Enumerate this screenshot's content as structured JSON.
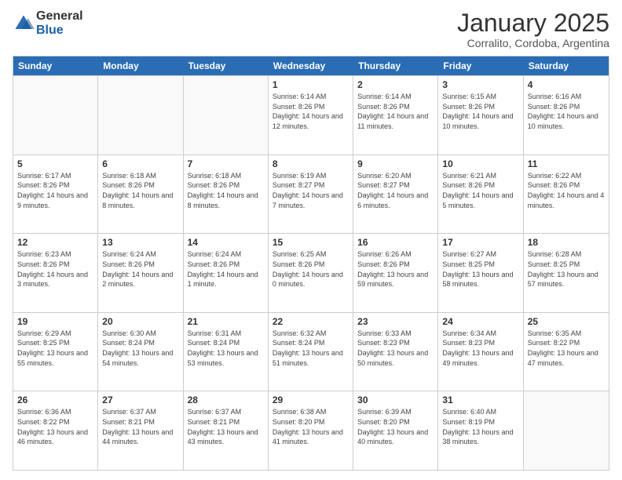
{
  "logo": {
    "general": "General",
    "blue": "Blue"
  },
  "header": {
    "month": "January 2025",
    "location": "Corralito, Cordoba, Argentina"
  },
  "days_of_week": [
    "Sunday",
    "Monday",
    "Tuesday",
    "Wednesday",
    "Thursday",
    "Friday",
    "Saturday"
  ],
  "weeks": [
    [
      {
        "day": "",
        "sunrise": "",
        "sunset": "",
        "daylight": "",
        "empty": true
      },
      {
        "day": "",
        "sunrise": "",
        "sunset": "",
        "daylight": "",
        "empty": true
      },
      {
        "day": "",
        "sunrise": "",
        "sunset": "",
        "daylight": "",
        "empty": true
      },
      {
        "day": "1",
        "sunrise": "Sunrise: 6:14 AM",
        "sunset": "Sunset: 8:26 PM",
        "daylight": "Daylight: 14 hours and 12 minutes."
      },
      {
        "day": "2",
        "sunrise": "Sunrise: 6:14 AM",
        "sunset": "Sunset: 8:26 PM",
        "daylight": "Daylight: 14 hours and 11 minutes."
      },
      {
        "day": "3",
        "sunrise": "Sunrise: 6:15 AM",
        "sunset": "Sunset: 8:26 PM",
        "daylight": "Daylight: 14 hours and 10 minutes."
      },
      {
        "day": "4",
        "sunrise": "Sunrise: 6:16 AM",
        "sunset": "Sunset: 8:26 PM",
        "daylight": "Daylight: 14 hours and 10 minutes."
      }
    ],
    [
      {
        "day": "5",
        "sunrise": "Sunrise: 6:17 AM",
        "sunset": "Sunset: 8:26 PM",
        "daylight": "Daylight: 14 hours and 9 minutes."
      },
      {
        "day": "6",
        "sunrise": "Sunrise: 6:18 AM",
        "sunset": "Sunset: 8:26 PM",
        "daylight": "Daylight: 14 hours and 8 minutes."
      },
      {
        "day": "7",
        "sunrise": "Sunrise: 6:18 AM",
        "sunset": "Sunset: 8:26 PM",
        "daylight": "Daylight: 14 hours and 8 minutes."
      },
      {
        "day": "8",
        "sunrise": "Sunrise: 6:19 AM",
        "sunset": "Sunset: 8:27 PM",
        "daylight": "Daylight: 14 hours and 7 minutes."
      },
      {
        "day": "9",
        "sunrise": "Sunrise: 6:20 AM",
        "sunset": "Sunset: 8:27 PM",
        "daylight": "Daylight: 14 hours and 6 minutes."
      },
      {
        "day": "10",
        "sunrise": "Sunrise: 6:21 AM",
        "sunset": "Sunset: 8:26 PM",
        "daylight": "Daylight: 14 hours and 5 minutes."
      },
      {
        "day": "11",
        "sunrise": "Sunrise: 6:22 AM",
        "sunset": "Sunset: 8:26 PM",
        "daylight": "Daylight: 14 hours and 4 minutes."
      }
    ],
    [
      {
        "day": "12",
        "sunrise": "Sunrise: 6:23 AM",
        "sunset": "Sunset: 8:26 PM",
        "daylight": "Daylight: 14 hours and 3 minutes."
      },
      {
        "day": "13",
        "sunrise": "Sunrise: 6:24 AM",
        "sunset": "Sunset: 8:26 PM",
        "daylight": "Daylight: 14 hours and 2 minutes."
      },
      {
        "day": "14",
        "sunrise": "Sunrise: 6:24 AM",
        "sunset": "Sunset: 8:26 PM",
        "daylight": "Daylight: 14 hours and 1 minute."
      },
      {
        "day": "15",
        "sunrise": "Sunrise: 6:25 AM",
        "sunset": "Sunset: 8:26 PM",
        "daylight": "Daylight: 14 hours and 0 minutes."
      },
      {
        "day": "16",
        "sunrise": "Sunrise: 6:26 AM",
        "sunset": "Sunset: 8:26 PM",
        "daylight": "Daylight: 13 hours and 59 minutes."
      },
      {
        "day": "17",
        "sunrise": "Sunrise: 6:27 AM",
        "sunset": "Sunset: 8:25 PM",
        "daylight": "Daylight: 13 hours and 58 minutes."
      },
      {
        "day": "18",
        "sunrise": "Sunrise: 6:28 AM",
        "sunset": "Sunset: 8:25 PM",
        "daylight": "Daylight: 13 hours and 57 minutes."
      }
    ],
    [
      {
        "day": "19",
        "sunrise": "Sunrise: 6:29 AM",
        "sunset": "Sunset: 8:25 PM",
        "daylight": "Daylight: 13 hours and 55 minutes."
      },
      {
        "day": "20",
        "sunrise": "Sunrise: 6:30 AM",
        "sunset": "Sunset: 8:24 PM",
        "daylight": "Daylight: 13 hours and 54 minutes."
      },
      {
        "day": "21",
        "sunrise": "Sunrise: 6:31 AM",
        "sunset": "Sunset: 8:24 PM",
        "daylight": "Daylight: 13 hours and 53 minutes."
      },
      {
        "day": "22",
        "sunrise": "Sunrise: 6:32 AM",
        "sunset": "Sunset: 8:24 PM",
        "daylight": "Daylight: 13 hours and 51 minutes."
      },
      {
        "day": "23",
        "sunrise": "Sunrise: 6:33 AM",
        "sunset": "Sunset: 8:23 PM",
        "daylight": "Daylight: 13 hours and 50 minutes."
      },
      {
        "day": "24",
        "sunrise": "Sunrise: 6:34 AM",
        "sunset": "Sunset: 8:23 PM",
        "daylight": "Daylight: 13 hours and 49 minutes."
      },
      {
        "day": "25",
        "sunrise": "Sunrise: 6:35 AM",
        "sunset": "Sunset: 8:22 PM",
        "daylight": "Daylight: 13 hours and 47 minutes."
      }
    ],
    [
      {
        "day": "26",
        "sunrise": "Sunrise: 6:36 AM",
        "sunset": "Sunset: 8:22 PM",
        "daylight": "Daylight: 13 hours and 46 minutes."
      },
      {
        "day": "27",
        "sunrise": "Sunrise: 6:37 AM",
        "sunset": "Sunset: 8:21 PM",
        "daylight": "Daylight: 13 hours and 44 minutes."
      },
      {
        "day": "28",
        "sunrise": "Sunrise: 6:37 AM",
        "sunset": "Sunset: 8:21 PM",
        "daylight": "Daylight: 13 hours and 43 minutes."
      },
      {
        "day": "29",
        "sunrise": "Sunrise: 6:38 AM",
        "sunset": "Sunset: 8:20 PM",
        "daylight": "Daylight: 13 hours and 41 minutes."
      },
      {
        "day": "30",
        "sunrise": "Sunrise: 6:39 AM",
        "sunset": "Sunset: 8:20 PM",
        "daylight": "Daylight: 13 hours and 40 minutes."
      },
      {
        "day": "31",
        "sunrise": "Sunrise: 6:40 AM",
        "sunset": "Sunset: 8:19 PM",
        "daylight": "Daylight: 13 hours and 38 minutes."
      },
      {
        "day": "",
        "sunrise": "",
        "sunset": "",
        "daylight": "",
        "empty": true
      }
    ]
  ]
}
